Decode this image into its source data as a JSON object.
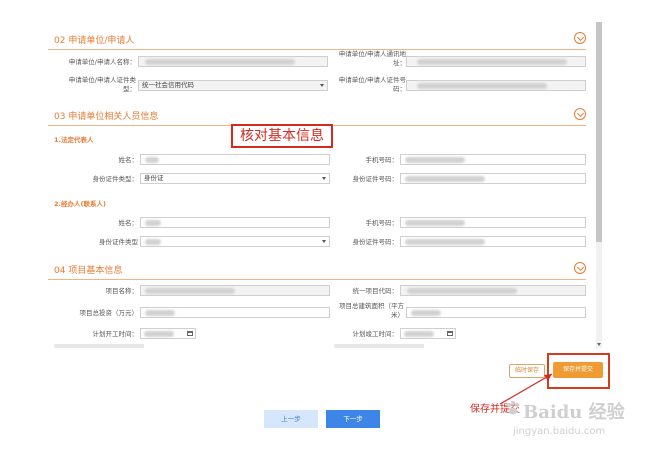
{
  "section02": {
    "title": "02 申请单位/申请人"
  },
  "section03": {
    "title": "03 申请单位相关人员信息"
  },
  "section04": {
    "title": "04 项目基本信息"
  },
  "applicant": {
    "name_label": "申请单位/申请人名称：",
    "address_label_1": "申请单位/申请人通讯地",
    "address_label_2": "址：",
    "id_type_label_1": "申请单位/申请人证件类",
    "id_type_label_2": "型：",
    "id_type_value": "统一社会信用代码",
    "id_no_label_1": "申请单位/申请人证件号",
    "id_no_label_2": "码："
  },
  "legal_rep": {
    "heading": "1.法定代表人",
    "name_label": "姓名：",
    "phone_label": "手机号码：",
    "id_type_label": "身份证件类型：",
    "id_type_value": "身份证",
    "id_no_label": "身份证件号码："
  },
  "agent": {
    "heading": "2.经办人(联系人)",
    "name_label": "姓名：",
    "phone_label": "手机号码：",
    "id_type_label": "身份证件类型",
    "id_no_label": "身份证件号码："
  },
  "project": {
    "name_label": "项目名称：",
    "code_label": "统一项目代码：",
    "investment_label": "项目总投资（万元）",
    "area_label_1": "项目总建筑面积（平方",
    "area_label_2": "米）",
    "start_label": "计划开工时间：",
    "end_label": "计划竣工时间："
  },
  "annotation": {
    "text": "核对基本信息",
    "color": "#d42a22"
  },
  "buttons": {
    "temp_save": "临时保存",
    "save_submit": "保存并提交",
    "prev": "上一步",
    "next": "下一步"
  },
  "note": {
    "save_note": "保存并提交"
  },
  "watermark": {
    "brand": "Baidu 经验",
    "url": "jingyan.baidu.com"
  },
  "colors": {
    "accent": "#e97a34",
    "primary": "#3d85e6",
    "highlight": "#d42a22",
    "submit": "#ef9a33"
  }
}
